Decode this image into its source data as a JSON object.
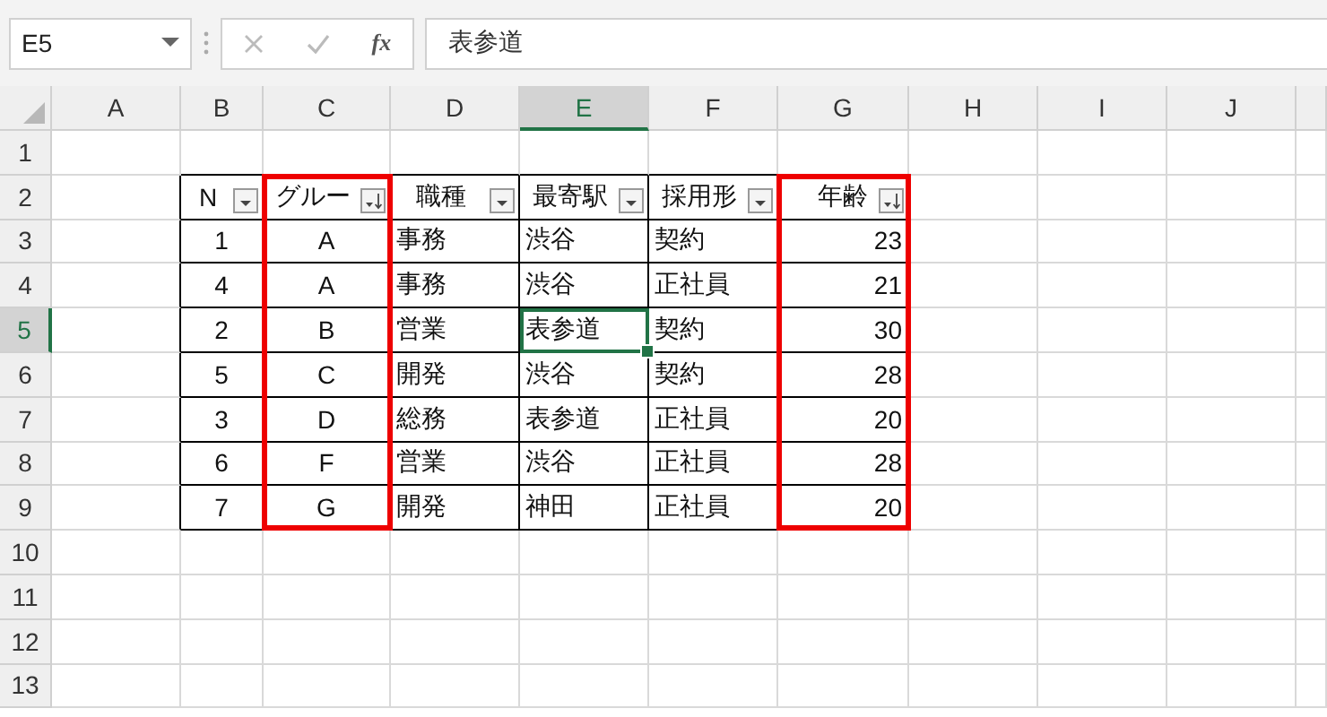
{
  "formula_bar": {
    "name_box": "E5",
    "function_label": "fx",
    "formula": "表参道"
  },
  "column_headers": [
    {
      "label": "A",
      "selected": false
    },
    {
      "label": "B",
      "selected": false
    },
    {
      "label": "C",
      "selected": false
    },
    {
      "label": "D",
      "selected": false
    },
    {
      "label": "E",
      "selected": true
    },
    {
      "label": "F",
      "selected": false
    },
    {
      "label": "G",
      "selected": false
    },
    {
      "label": "H",
      "selected": false
    },
    {
      "label": "I",
      "selected": false
    },
    {
      "label": "J",
      "selected": false
    }
  ],
  "row_headers": [
    {
      "label": "1",
      "selected": false
    },
    {
      "label": "2",
      "selected": false
    },
    {
      "label": "3",
      "selected": false
    },
    {
      "label": "4",
      "selected": false
    },
    {
      "label": "5",
      "selected": true
    },
    {
      "label": "6",
      "selected": false
    },
    {
      "label": "7",
      "selected": false
    },
    {
      "label": "8",
      "selected": false
    },
    {
      "label": "9",
      "selected": false
    },
    {
      "label": "10",
      "selected": false
    },
    {
      "label": "11",
      "selected": false
    },
    {
      "label": "12",
      "selected": false
    },
    {
      "label": "13",
      "selected": false
    }
  ],
  "table": {
    "columns": [
      {
        "label": "N",
        "kind": "center",
        "filter_button": {
          "kind": "plain"
        },
        "highlighted": false
      },
      {
        "label": "グルー",
        "kind": "center",
        "filter_button": {
          "kind": "sorted"
        },
        "highlighted": true
      },
      {
        "label": "職種",
        "kind": "text",
        "filter_button": {
          "kind": "plain"
        },
        "highlighted": false
      },
      {
        "label": "最寄駅",
        "kind": "text",
        "filter_button": {
          "kind": "plain"
        },
        "highlighted": false
      },
      {
        "label": "採用形",
        "kind": "text",
        "filter_button": {
          "kind": "plain"
        },
        "highlighted": false
      },
      {
        "label": "年齢",
        "kind": "number",
        "filter_button": {
          "kind": "sorted"
        },
        "highlighted": true
      }
    ],
    "rows": [
      [
        {
          "text": "1",
          "selected": false
        },
        {
          "text": "A",
          "selected": false
        },
        {
          "text": "事務",
          "selected": false
        },
        {
          "text": "渋谷",
          "selected": false
        },
        {
          "text": "契約",
          "selected": false
        },
        {
          "text": "23",
          "selected": false
        }
      ],
      [
        {
          "text": "4",
          "selected": false
        },
        {
          "text": "A",
          "selected": false
        },
        {
          "text": "事務",
          "selected": false
        },
        {
          "text": "渋谷",
          "selected": false
        },
        {
          "text": "正社員",
          "selected": false
        },
        {
          "text": "21",
          "selected": false
        }
      ],
      [
        {
          "text": "2",
          "selected": false
        },
        {
          "text": "B",
          "selected": false
        },
        {
          "text": "営業",
          "selected": false
        },
        {
          "text": "表参道",
          "selected": true
        },
        {
          "text": "契約",
          "selected": false
        },
        {
          "text": "30",
          "selected": false
        }
      ],
      [
        {
          "text": "5",
          "selected": false
        },
        {
          "text": "C",
          "selected": false
        },
        {
          "text": "開発",
          "selected": false
        },
        {
          "text": "渋谷",
          "selected": false
        },
        {
          "text": "契約",
          "selected": false
        },
        {
          "text": "28",
          "selected": false
        }
      ],
      [
        {
          "text": "3",
          "selected": false
        },
        {
          "text": "D",
          "selected": false
        },
        {
          "text": "総務",
          "selected": false
        },
        {
          "text": "表参道",
          "selected": false
        },
        {
          "text": "正社員",
          "selected": false
        },
        {
          "text": "20",
          "selected": false
        }
      ],
      [
        {
          "text": "6",
          "selected": false
        },
        {
          "text": "F",
          "selected": false
        },
        {
          "text": "営業",
          "selected": false
        },
        {
          "text": "渋谷",
          "selected": false
        },
        {
          "text": "正社員",
          "selected": false
        },
        {
          "text": "28",
          "selected": false
        }
      ],
      [
        {
          "text": "7",
          "selected": false
        },
        {
          "text": "G",
          "selected": false
        },
        {
          "text": "開発",
          "selected": false
        },
        {
          "text": "神田",
          "selected": false
        },
        {
          "text": "正社員",
          "selected": false
        },
        {
          "text": "20",
          "selected": false
        }
      ]
    ]
  }
}
